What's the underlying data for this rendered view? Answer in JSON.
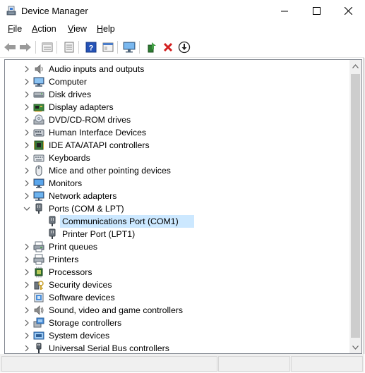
{
  "window": {
    "title": "Device Manager"
  },
  "menu": {
    "file": "File",
    "action": "Action",
    "view": "View",
    "help": "Help"
  },
  "toolbar": {
    "buttons": [
      "back-icon",
      "forward-icon",
      "properties-icon",
      "device-list-icon",
      "help-icon",
      "view-icon",
      "monitor-icon",
      "update-driver-icon",
      "uninstall-icon",
      "install-icon"
    ]
  },
  "tree": {
    "items": [
      {
        "label": "Audio inputs and outputs",
        "expanded": false
      },
      {
        "label": "Computer",
        "expanded": false
      },
      {
        "label": "Disk drives",
        "expanded": false
      },
      {
        "label": "Display adapters",
        "expanded": false
      },
      {
        "label": "DVD/CD-ROM drives",
        "expanded": false
      },
      {
        "label": "Human Interface Devices",
        "expanded": false
      },
      {
        "label": "IDE ATA/ATAPI controllers",
        "expanded": false
      },
      {
        "label": "Keyboards",
        "expanded": false
      },
      {
        "label": "Mice and other pointing devices",
        "expanded": false
      },
      {
        "label": "Monitors",
        "expanded": false
      },
      {
        "label": "Network adapters",
        "expanded": false
      },
      {
        "label": "Ports (COM & LPT)",
        "expanded": true
      },
      {
        "label": "Communications Port (COM1)",
        "child": true,
        "selected": true
      },
      {
        "label": "Printer Port (LPT1)",
        "child": true
      },
      {
        "label": "Print queues",
        "expanded": false
      },
      {
        "label": "Printers",
        "expanded": false
      },
      {
        "label": "Processors",
        "expanded": false
      },
      {
        "label": "Security devices",
        "expanded": false
      },
      {
        "label": "Software devices",
        "expanded": false
      },
      {
        "label": "Sound, video and game controllers",
        "expanded": false
      },
      {
        "label": "Storage controllers",
        "expanded": false
      },
      {
        "label": "System devices",
        "expanded": false
      },
      {
        "label": "Universal Serial Bus controllers",
        "expanded": false
      }
    ]
  },
  "colors": {
    "selection": "#cce8ff",
    "accent": "#1e3c8c"
  }
}
